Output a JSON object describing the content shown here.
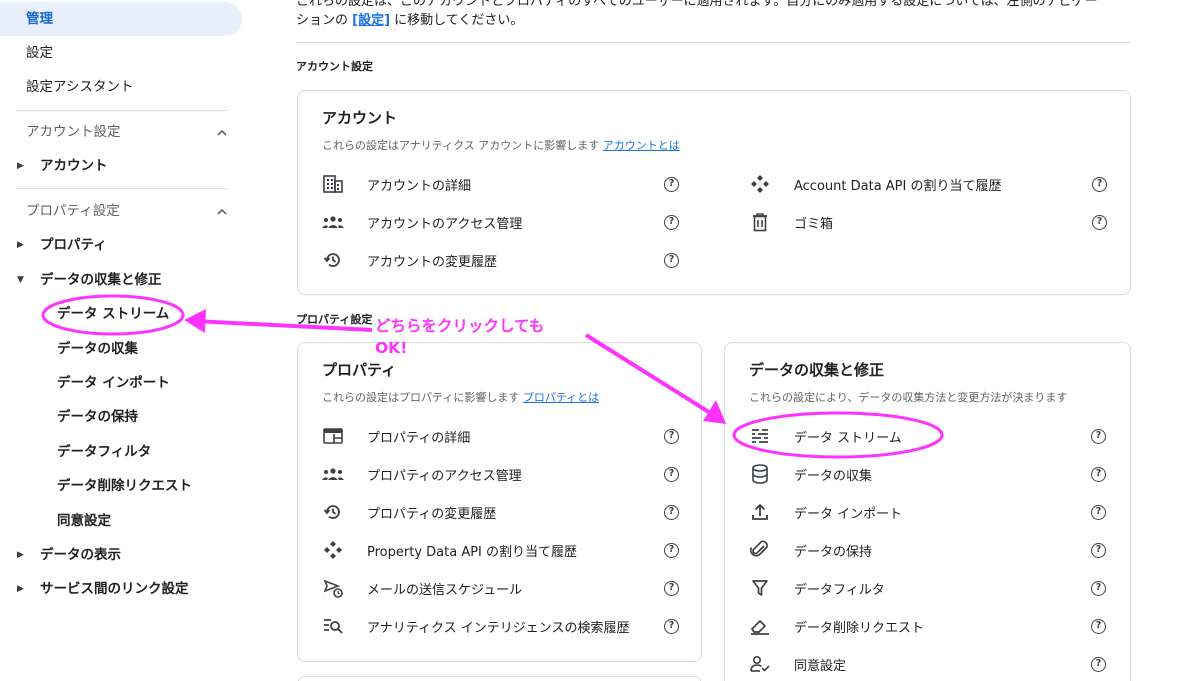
{
  "sidebar": {
    "items": [
      {
        "label": "管理"
      },
      {
        "label": "設定"
      },
      {
        "label": "設定アシスタント"
      }
    ],
    "account_section": "アカウント設定",
    "account_item": "アカウント",
    "property_section": "プロパティ設定",
    "property_item": "プロパティ",
    "data_collection_parent": "データの収集と修正",
    "sub_items": [
      "データ ストリーム",
      "データの収集",
      "データ インポート",
      "データの保持",
      "データフィルタ",
      "データ削除リクエスト",
      "同意設定"
    ],
    "data_display": "データの表示",
    "service_links": "サービス間のリンク設定",
    "chevron_up": "^"
  },
  "main": {
    "top_note_line1": "これらの設定は、このアカウントとプロパティのすべてのユーザーに適用されます。自分にのみ適用する設定については、左側のナビゲー",
    "top_note_line2_prefix": "ションの ",
    "top_note_link": "[設定]",
    "top_note_line2_suffix": " に移動してください。",
    "account_settings_label": "アカウント設定",
    "property_settings_label": "プロパティ設定",
    "account_card": {
      "title": "アカウント",
      "subtitle": "これらの設定はアナリティクス アカウントに影響します",
      "link": "アカウントとは",
      "left_rows": [
        "アカウントの詳細",
        "アカウントのアクセス管理",
        "アカウントの変更履歴"
      ],
      "right_rows": [
        "Account Data API の割り当て履歴",
        "ゴミ箱"
      ]
    },
    "property_card": {
      "title": "プロパティ",
      "subtitle": "これらの設定はプロパティに影響します",
      "link": "プロパティとは",
      "rows": [
        "プロパティの詳細",
        "プロパティのアクセス管理",
        "プロパティの変更履歴",
        "Property Data API の割り当て履歴",
        "メールの送信スケジュール",
        "アナリティクス インテリジェンスの検索履歴"
      ]
    },
    "data_card": {
      "title": "データの収集と修正",
      "subtitle": "これらの設定により、データの収集方法と変更方法が決まります",
      "rows": [
        "データ ストリーム",
        "データの収集",
        "データ インポート",
        "データの保持",
        "データフィルタ",
        "データ削除リクエスト",
        "同意設定"
      ]
    },
    "help_glyph": "?"
  },
  "annotation": {
    "line1": "どちらをクリックしても",
    "line2": "OK!",
    "color": "#ff33ff"
  }
}
